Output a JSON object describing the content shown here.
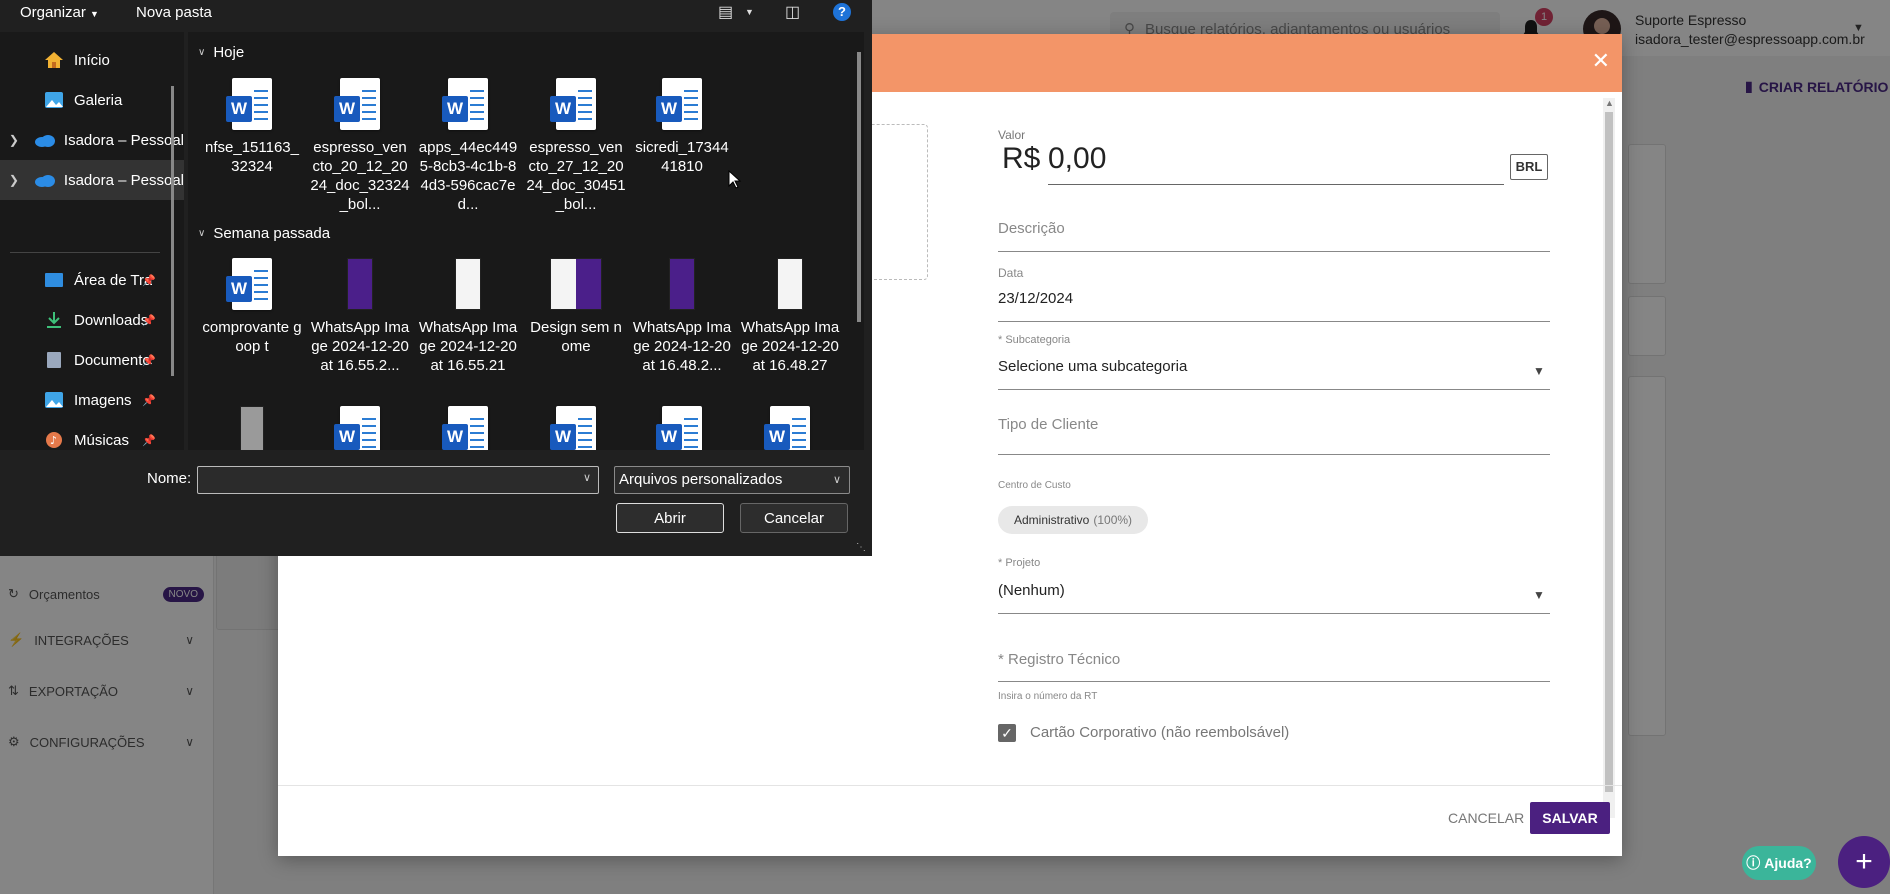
{
  "app": {
    "search_placeholder": "Busque relatórios, adiantamentos ou usuários",
    "notification_count": "1",
    "user_name": "Suporte Espresso",
    "user_email": "isadora_tester@espressoapp.com.br",
    "criar_relatorio": "CRIAR RELATÓRIO",
    "sidebar": [
      {
        "label": "Orçamentos",
        "badge": "NOVO",
        "icon": "budget-icon"
      },
      {
        "label": "INTEGRAÇÕES",
        "icon": "plug-icon"
      },
      {
        "label": "EXPORTAÇÃO",
        "icon": "export-icon"
      },
      {
        "label": "CONFIGURAÇÕES",
        "icon": "gear-icon"
      }
    ],
    "help_label": "Ajuda?",
    "fab_label": "+"
  },
  "modal": {
    "header_color": "#f39568",
    "valor_label": "Valor",
    "currency_symbol": "R$",
    "valor_value": "0,00",
    "currency_code": "BRL",
    "descricao_placeholder": "Descrição",
    "data_label": "Data",
    "data_value": "23/12/2024",
    "subcategoria_label": "* Subcategoria",
    "subcategoria_value": "Selecione uma subcategoria",
    "tipo_cliente_placeholder": "Tipo de Cliente",
    "centro_custo_label": "Centro de Custo",
    "centro_custo_chip": "Administrativo",
    "centro_custo_pct": "(100%)",
    "projeto_label": "* Projeto",
    "projeto_value": "(Nenhum)",
    "registro_placeholder": "* Registro Técnico",
    "registro_hint": "Insira o número da RT",
    "cartao_label": "Cartão Corporativo (não reembolsável)",
    "cartao_checked": true,
    "cancel_label": "CANCELAR",
    "save_label": "SALVAR",
    "save_color": "#4b2080"
  },
  "dialog": {
    "toolbar": {
      "organizar": "Organizar",
      "nova_pasta": "Nova pasta",
      "help": "?"
    },
    "nav": [
      {
        "label": "Início",
        "icon": "home-icon"
      },
      {
        "label": "Galeria",
        "icon": "gallery-icon"
      },
      {
        "label": "Isadora – Pessoal",
        "icon": "onedrive-icon",
        "expandable": true
      },
      {
        "label": "Isadora – Pessoal",
        "icon": "onedrive-icon",
        "expandable": true,
        "selected": true
      },
      {
        "label": "Área de Trabalho",
        "icon": "desktop-icon",
        "pinned": true
      },
      {
        "label": "Downloads",
        "icon": "download-icon",
        "pinned": true
      },
      {
        "label": "Documentos",
        "icon": "documents-icon",
        "pinned": true
      },
      {
        "label": "Imagens",
        "icon": "pictures-icon",
        "pinned": true
      },
      {
        "label": "Músicas",
        "icon": "music-icon",
        "pinned": true
      }
    ],
    "groups": [
      {
        "label": "Hoje",
        "files": [
          {
            "name": "nfse_151163_32324",
            "type": "word"
          },
          {
            "name": "espresso_vencto_20_12_2024_doc_32324_bol...",
            "type": "word"
          },
          {
            "name": "apps_44ec4495-8cb3-4c1b-84d3-596cac7ed...",
            "type": "word"
          },
          {
            "name": "espresso_vencto_27_12_2024_doc_30451_bol...",
            "type": "word"
          },
          {
            "name": "sicredi_1734441810",
            "type": "word"
          }
        ]
      },
      {
        "label": "Semana passada",
        "files": [
          {
            "name": "comprovante goop t",
            "type": "word"
          },
          {
            "name": "WhatsApp Image 2024-12-20 at 16.55.2...",
            "type": "phone-dark"
          },
          {
            "name": "WhatsApp Image 2024-12-20 at 16.55.21",
            "type": "phone-light"
          },
          {
            "name": "Design sem nome",
            "type": "phone-mix"
          },
          {
            "name": "WhatsApp Image 2024-12-20 at 16.48.2...",
            "type": "phone-dark"
          },
          {
            "name": "WhatsApp Image 2024-12-20 at 16.48.27",
            "type": "phone-light"
          }
        ]
      }
    ],
    "bottom": {
      "nome_label": "Nome:",
      "nome_value": "",
      "tipo_value": "Arquivos personalizados",
      "abrir_label": "Abrir",
      "cancelar_label": "Cancelar"
    }
  }
}
